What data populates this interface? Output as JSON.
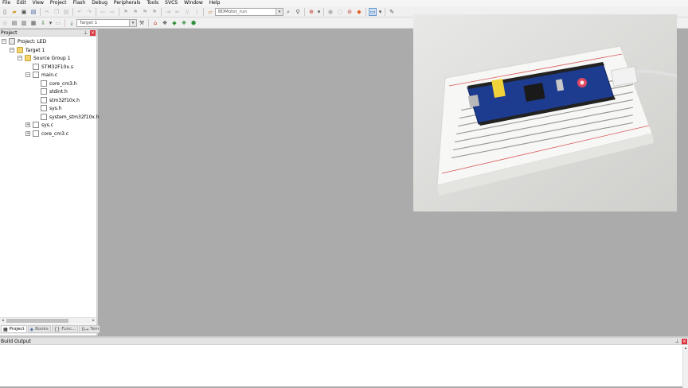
{
  "menu": [
    "File",
    "Edit",
    "View",
    "Project",
    "Flash",
    "Debug",
    "Peripherals",
    "Tools",
    "SVCS",
    "Window",
    "Help"
  ],
  "toolbar": {
    "target_combo": "BDMotor_run",
    "build_target": "Target 1"
  },
  "project_panel": {
    "title": "Project",
    "pin_icon": "pin-icon",
    "tree": [
      {
        "label": "Project: LED",
        "level": 0,
        "expander": "−",
        "icon": "project"
      },
      {
        "label": "Target 1",
        "level": 1,
        "expander": "−",
        "icon": "folder"
      },
      {
        "label": "Source Group 1",
        "level": 2,
        "expander": "−",
        "icon": "folder"
      },
      {
        "label": "STM32F10x.s",
        "level": 3,
        "expander": "",
        "icon": "file"
      },
      {
        "label": "main.c",
        "level": 3,
        "expander": "−",
        "icon": "file"
      },
      {
        "label": "core_cm3.h",
        "level": 4,
        "expander": "",
        "icon": "file"
      },
      {
        "label": "stdint.h",
        "level": 4,
        "expander": "",
        "icon": "file"
      },
      {
        "label": "stm32f10x.h",
        "level": 4,
        "expander": "",
        "icon": "file"
      },
      {
        "label": "sys.h",
        "level": 4,
        "expander": "",
        "icon": "file"
      },
      {
        "label": "system_stm32f10x.h",
        "level": 4,
        "expander": "",
        "icon": "file"
      },
      {
        "label": "sys.c",
        "level": 3,
        "expander": "+",
        "icon": "file"
      },
      {
        "label": "core_cm3.c",
        "level": 3,
        "expander": "+",
        "icon": "file"
      }
    ],
    "tabs": [
      {
        "label": "Project",
        "icon": "▦",
        "active": true
      },
      {
        "label": "Books",
        "icon": "◈",
        "active": false
      },
      {
        "label": "Func...",
        "icon": "{}",
        "active": false
      },
      {
        "label": "Temp...",
        "icon": "0→",
        "active": false
      }
    ]
  },
  "build_output": {
    "title": "Build Output"
  },
  "colors": {
    "workspace": "#ababab",
    "close": "#d9363e",
    "folder": "#f4d56b"
  }
}
